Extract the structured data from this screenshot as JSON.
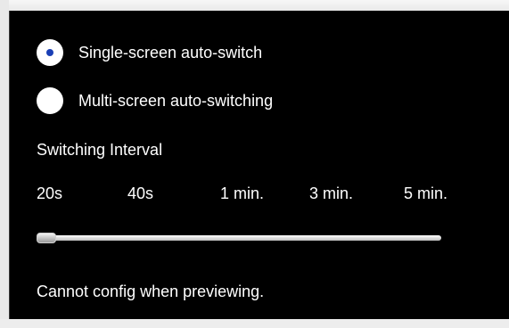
{
  "colors": {
    "panel_background": "#000000",
    "text": "#ffffff",
    "radio_selected_dot": "#1a3fb5"
  },
  "mode_options": [
    {
      "label": "Single-screen auto-switch",
      "selected": true
    },
    {
      "label": "Multi-screen auto-switching",
      "selected": false
    }
  ],
  "interval": {
    "title": "Switching Interval",
    "ticks": [
      "20s",
      "40s",
      "1 min.",
      "3 min.",
      "5 min."
    ],
    "selected_index": 0,
    "selected_value": "20s"
  },
  "status": {
    "message": "Cannot config when previewing."
  }
}
